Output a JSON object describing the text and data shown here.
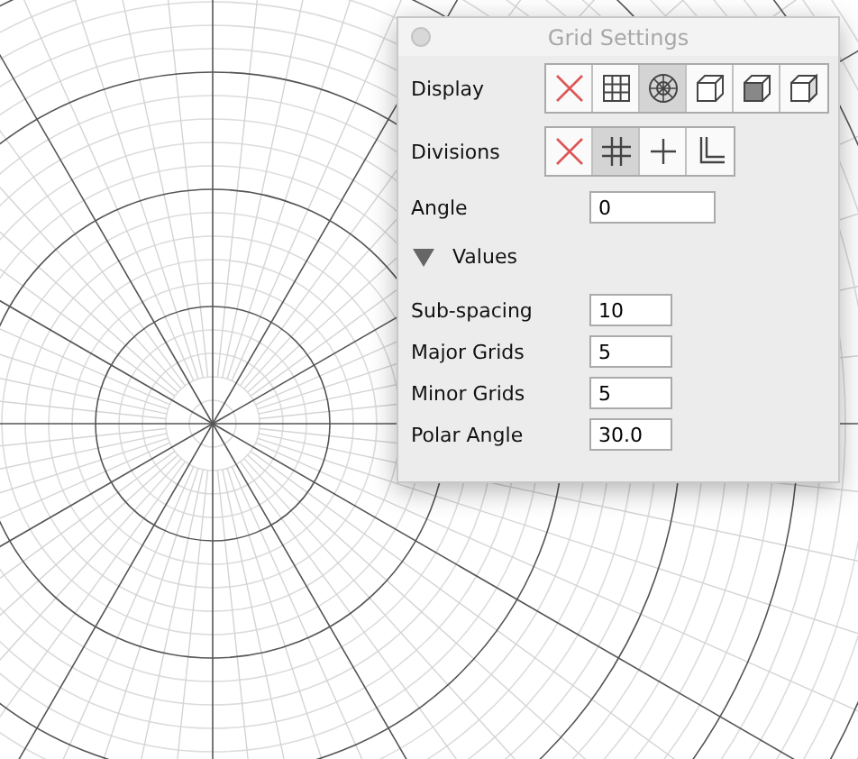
{
  "window": {
    "title": "Grid Settings"
  },
  "display": {
    "label": "Display",
    "options": [
      {
        "kind": "none",
        "selected": false
      },
      {
        "kind": "rectangular",
        "selected": false
      },
      {
        "kind": "polar",
        "selected": true
      },
      {
        "kind": "cube",
        "selected": false
      },
      {
        "kind": "cube-shaded",
        "selected": false
      },
      {
        "kind": "cube-side",
        "selected": false
      }
    ]
  },
  "divisions": {
    "label": "Divisions",
    "options": [
      {
        "kind": "none",
        "selected": false
      },
      {
        "kind": "cross-hatch",
        "selected": true
      },
      {
        "kind": "tee",
        "selected": false
      },
      {
        "kind": "corner",
        "selected": false
      }
    ]
  },
  "angle": {
    "label": "Angle",
    "value": "0"
  },
  "values": {
    "label": "Values",
    "expanded": true,
    "fields": [
      {
        "label": "Sub-spacing",
        "value": "10"
      },
      {
        "label": "Major Grids",
        "value": "5"
      },
      {
        "label": "Minor Grids",
        "value": "5"
      },
      {
        "label": "Polar Angle",
        "value": "30.0"
      }
    ]
  }
}
